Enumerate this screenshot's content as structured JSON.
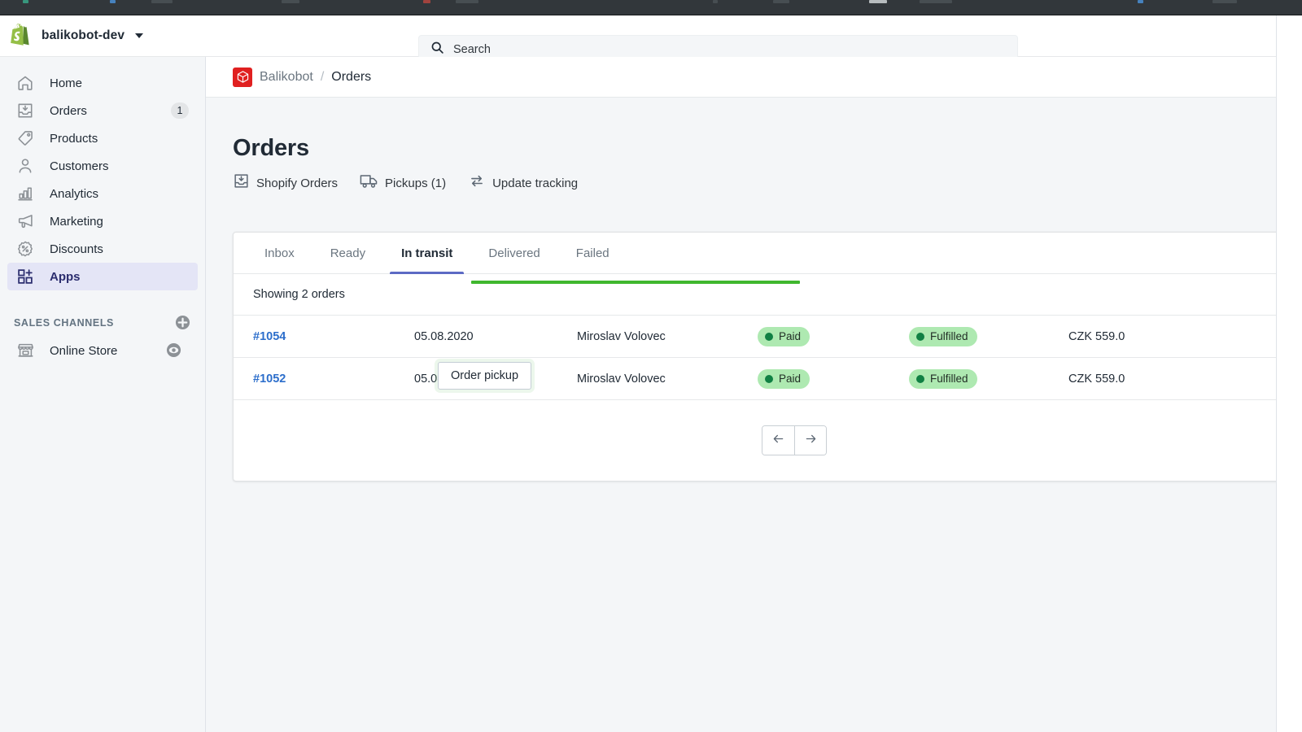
{
  "topbar": {
    "shop_name": "balikobot-dev",
    "shop_logo_icon": "shopify-bag-icon",
    "caret_icon": "chevron-down-icon",
    "search_icon": "search-icon",
    "search_placeholder": "Search",
    "search_value": ""
  },
  "sidebar": {
    "items": [
      {
        "label": "Home",
        "icon": "home-icon",
        "badge": "",
        "active": false
      },
      {
        "label": "Orders",
        "icon": "orders-icon",
        "badge": "1",
        "active": false
      },
      {
        "label": "Products",
        "icon": "tag-icon",
        "badge": "",
        "active": false
      },
      {
        "label": "Customers",
        "icon": "person-icon",
        "badge": "",
        "active": false
      },
      {
        "label": "Analytics",
        "icon": "bar-chart-icon",
        "badge": "",
        "active": false
      },
      {
        "label": "Marketing",
        "icon": "megaphone-icon",
        "badge": "",
        "active": false
      },
      {
        "label": "Discounts",
        "icon": "discount-icon",
        "badge": "",
        "active": false
      },
      {
        "label": "Apps",
        "icon": "apps-icon",
        "badge": "",
        "active": true
      }
    ],
    "sales_channels": {
      "title": "SALES CHANNELS",
      "add_icon": "plus-circle-icon",
      "items": [
        {
          "label": "Online Store",
          "icon": "storefront-icon",
          "action_icon": "eye-icon"
        }
      ]
    }
  },
  "breadcrumb": {
    "app_icon": "balikobot-cube-icon",
    "app_name": "Balikobot",
    "separator": "/",
    "current": "Orders"
  },
  "page": {
    "title": "Orders",
    "actions": [
      {
        "label": "Shopify Orders",
        "icon": "import-orders-icon"
      },
      {
        "label": "Pickups (1)",
        "icon": "truck-icon"
      },
      {
        "label": "Update tracking",
        "icon": "refresh-icon"
      }
    ]
  },
  "tabs": [
    {
      "label": "Inbox",
      "active": false
    },
    {
      "label": "Ready",
      "active": false
    },
    {
      "label": "In transit",
      "active": true
    },
    {
      "label": "Delivered",
      "active": false
    },
    {
      "label": "Failed",
      "active": false
    }
  ],
  "table": {
    "showing_text": "Showing 2 orders",
    "progress_percent": 100,
    "rows": [
      {
        "order_id": "#1054",
        "date": "05.08.2020",
        "customer": "Miroslav Volovec",
        "payment_status": "Paid",
        "fulfillment_status": "Fulfilled",
        "total": "CZK 559.0"
      },
      {
        "order_id": "#1052",
        "date": "05.08.2020",
        "customer": "Miroslav Volovec",
        "payment_status": "Paid",
        "fulfillment_status": "Fulfilled",
        "total": "CZK 559.0"
      }
    ]
  },
  "tooltip": {
    "label": "Order pickup"
  },
  "pagination": {
    "prev_icon": "arrow-left-icon",
    "next_icon": "arrow-right-icon"
  },
  "colors": {
    "accent": "#5c6ac4",
    "link": "#2c6ecb",
    "success": "#108043",
    "success_bg": "#aee9b1",
    "progress": "#3fb72e",
    "brand_red": "#e02020"
  }
}
